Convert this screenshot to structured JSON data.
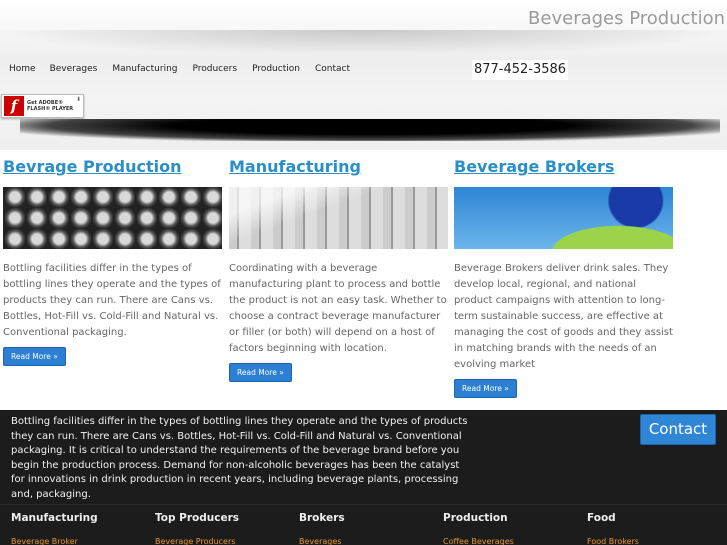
{
  "header": {
    "site_title": "Beverages Production",
    "phone": "877-452-3586",
    "nav": [
      "Home",
      "Beverages",
      "Manufacturing",
      "Producers",
      "Production",
      "Contact"
    ],
    "flash_badge": {
      "line1": "Get ADOBE®",
      "line2": "FLASH® PLAYER",
      "icon": "flash-icon"
    }
  },
  "columns": [
    {
      "title": "Bevrage Production",
      "image": "cans-image",
      "text": "Bottling facilities differ in the types of bottling lines they operate and the types of products they can run. There are Cans vs. Bottles, Hot-Fill vs. Cold-Fill and Natural vs. Conventional packaging.",
      "button": "Read More »"
    },
    {
      "title": "Manufacturing",
      "image": "production-line-image",
      "text": "Coordinating with a beverage manufacturing plant to process and bottle the product is not an easy task. Whether to choose a contract beverage manufacturer or filler (or both) will depend on a host of factors beginning with location.",
      "button": "Read More »"
    },
    {
      "title": "Beverage Brokers",
      "image": "bottle-image",
      "text": "Beverage Brokers deliver drink sales. They develop local, regional, and national product campaigns with attention to long-term sustainable success, are effective at managing the cost of goods and they assist in matching brands with the needs of an evolving market",
      "button": "Read More »"
    }
  ],
  "banner": {
    "text": "Bottling facilities differ in the types of bottling lines they operate and the types of products they can run. There are Cans vs. Bottles, Hot-Fill vs. Cold-Fill and Natural vs. Conventional packaging. It is critical to understand the requirements of the beverage brand before you begin the production process. Demand for non-alcoholic beverages has been the catalyst for innovations in drink production in recent years, including beverage plants, processing and, packaging.",
    "contact_button": "Contact"
  },
  "footer": [
    {
      "heading": "Manufacturing",
      "link": "Beverage Broker"
    },
    {
      "heading": "Top Producers",
      "link": "Beverage Producers"
    },
    {
      "heading": "Brokers",
      "link": "Beverages"
    },
    {
      "heading": "Production",
      "link": "Coffee Beverages"
    },
    {
      "heading": "Food",
      "link": "Food Brokers"
    }
  ],
  "colors": {
    "accent": "#2a8fc6",
    "button": "#2d7fd4",
    "footer_link": "#e8962e",
    "dark_band": "#1c1c1c"
  }
}
